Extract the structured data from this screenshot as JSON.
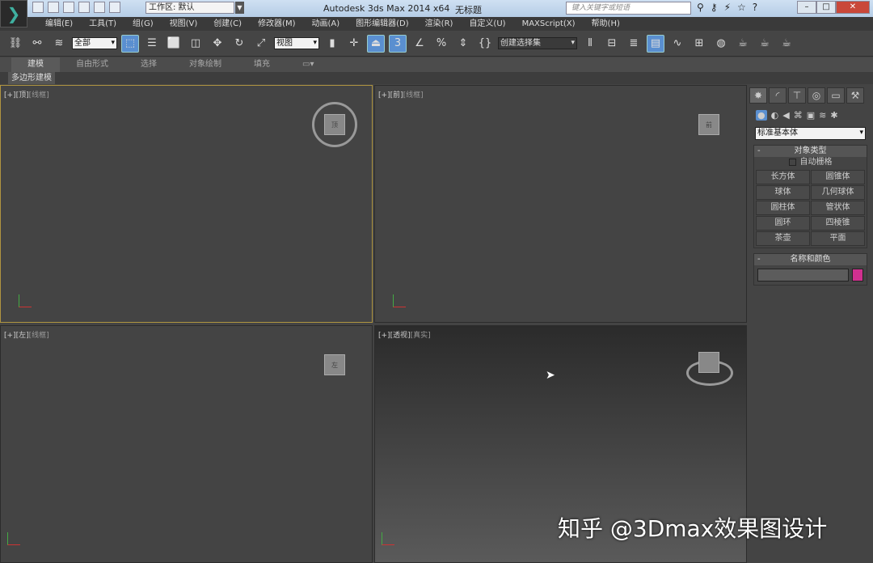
{
  "title": {
    "workspace": "工作区: 默认",
    "app": "Autodesk 3ds Max  2014 x64",
    "doc": "无标题",
    "search_placeholder": "键入关键字或短语"
  },
  "menu": [
    "编辑(E)",
    "工具(T)",
    "组(G)",
    "视图(V)",
    "创建(C)",
    "修改器(M)",
    "动画(A)",
    "图形编辑器(D)",
    "渲染(R)",
    "自定义(U)",
    "MAXScript(X)",
    "帮助(H)"
  ],
  "toolbar": {
    "filter": "全部",
    "coord": "视图",
    "selset": "创建选择集"
  },
  "ribbon": {
    "tabs": [
      "建模",
      "自由形式",
      "选择",
      "对象绘制",
      "填充"
    ],
    "sub": "多边形建模"
  },
  "viewports": [
    {
      "plus": "[+]",
      "view": "[顶]",
      "mode": "[线框]",
      "cube": "顶"
    },
    {
      "plus": "[+]",
      "view": "[前]",
      "mode": "[线框]",
      "cube": "前"
    },
    {
      "plus": "[+]",
      "view": "[左]",
      "mode": "[线框]",
      "cube": "左"
    },
    {
      "plus": "[+]",
      "view": "[透视]",
      "mode": "[真实]",
      "cube": ""
    }
  ],
  "panel": {
    "category": "标准基本体",
    "rollout1": "对象类型",
    "autogrid": "自动栅格",
    "buttons": [
      "长方体",
      "圆锥体",
      "球体",
      "几何球体",
      "圆柱体",
      "管状体",
      "圆环",
      "四棱锥",
      "茶壶",
      "平面"
    ],
    "rollout2": "名称和颜色",
    "color": "#d0308f"
  },
  "watermark": "知乎 @3Dmax效果图设计"
}
